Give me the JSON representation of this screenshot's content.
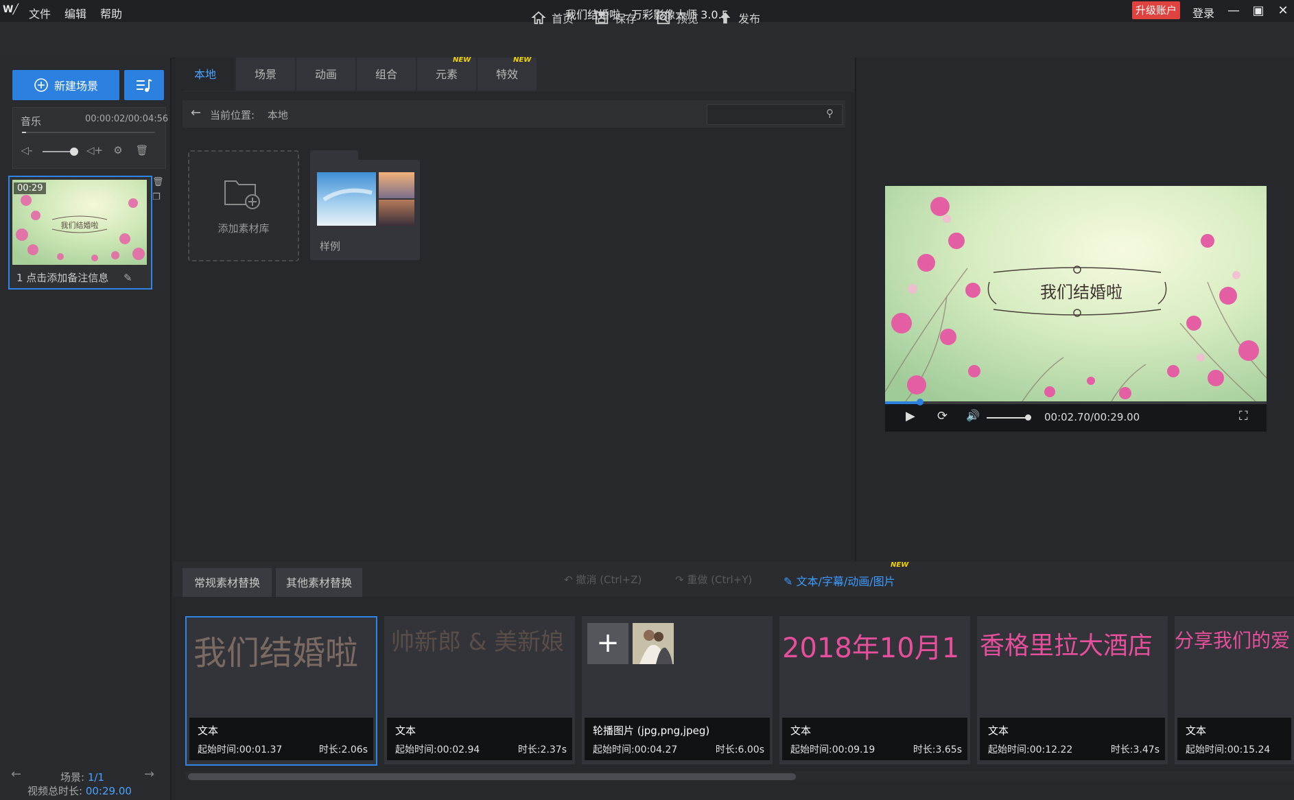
{
  "titlebar": {
    "logo": "W╱",
    "menu": [
      "文件",
      "编辑",
      "帮助"
    ],
    "title": "我们结婚啦 - 万彩影像大师 3.0.5",
    "upgrade": "升级账户",
    "login": "登录"
  },
  "toolbar": {
    "home": "首页",
    "save": "保存",
    "preview": "预览",
    "publish": "发布"
  },
  "left": {
    "new_scene": "新建场景",
    "music_label": "音乐",
    "music_time": "00:00:02/00:04:56",
    "scene_time": "00:29",
    "scene_caption": "1   点击添加备注信息",
    "scene_thumb_title": "我们结婚啦",
    "scene_count_label": "场景: ",
    "scene_count": "1/1",
    "total_label": "视频总时长: ",
    "total_time": "00:29.00"
  },
  "tabs": [
    {
      "label": "本地",
      "new": false
    },
    {
      "label": "场景",
      "new": false
    },
    {
      "label": "动画",
      "new": false
    },
    {
      "label": "组合",
      "new": false
    },
    {
      "label": "元素",
      "new": true
    },
    {
      "label": "特效",
      "new": true
    }
  ],
  "new_tag": "NEW",
  "path": {
    "label": "当前位置:",
    "value": "本地"
  },
  "library": {
    "add_label": "添加素材库",
    "sample_label": "样例"
  },
  "preview": {
    "title_text": "我们结婚啦",
    "time": "00:02.70/00:29.00",
    "progress": 0.093
  },
  "bottom": {
    "tab1": "常规素材替换",
    "tab2": "其他素材替换",
    "undo": "撤消 (Ctrl+Z)",
    "redo": "重做 (Ctrl+Y)",
    "text_link": "文本/字幕/动画/图片"
  },
  "cards": [
    {
      "text": "我们结婚啦",
      "color": "#7a6a62",
      "type": "文本",
      "start": "起始时间:00:01.37",
      "dur": "时长:2.06s"
    },
    {
      "text": "帅新郎 & 美新娘",
      "color": "#5a4d48",
      "type": "文本",
      "start": "起始时间:00:02.94",
      "dur": "时长:2.37s"
    },
    {
      "text": "",
      "color": "#ffffff",
      "type": "轮播图片 (jpg,png,jpeg)",
      "start": "起始时间:00:04.27",
      "dur": "时长:6.00s"
    },
    {
      "text": "2018年10月1日",
      "color": "#e64f9c",
      "type": "文本",
      "start": "起始时间:00:09.19",
      "dur": "时长:3.65s"
    },
    {
      "text": "香格里拉大酒店",
      "color": "#e64f9c",
      "type": "文本",
      "start": "起始时间:00:12.22",
      "dur": "时长:3.47s"
    },
    {
      "text": "分享我们的爱",
      "color": "#e64f9c",
      "type": "文本",
      "start": "起始时间:00:15.24",
      "dur": ""
    }
  ]
}
